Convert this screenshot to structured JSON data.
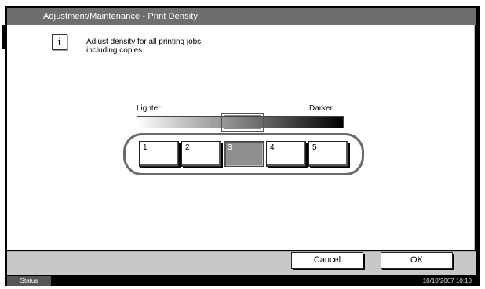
{
  "window": {
    "title": "Adjustment/Maintenance - Print Density"
  },
  "info": {
    "icon": "info-icon",
    "glyph": "i",
    "line1": "Adjust density for all printing jobs,",
    "line2": "including copies."
  },
  "density": {
    "label_lighter": "Lighter",
    "label_darker": "Darker",
    "levels": [
      "1",
      "2",
      "3",
      "4",
      "5"
    ],
    "selected_level": "3"
  },
  "actions": {
    "cancel_label": "Cancel",
    "ok_label": "OK"
  },
  "status_bar": {
    "status_label": "Status",
    "datetime": "10/10/2007   10:10"
  },
  "colors": {
    "title_bar": "#6e6e6e",
    "selected_button": "#8f8f8f",
    "bottom_bar": "#c8c8c8"
  }
}
